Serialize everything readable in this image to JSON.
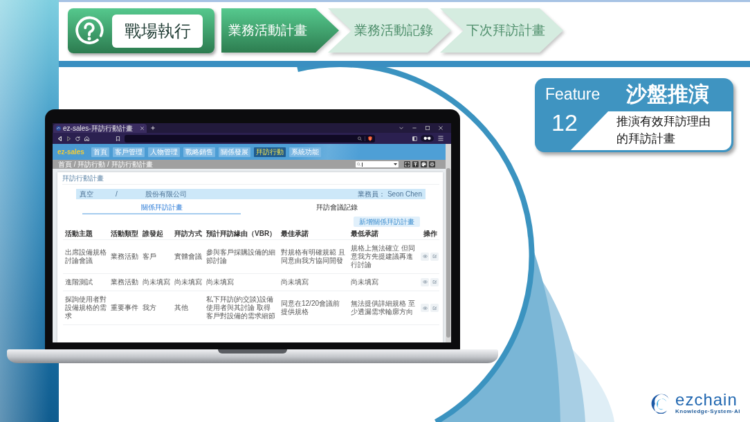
{
  "header": {
    "badge": "戰場執行",
    "steps": [
      {
        "label": "業務活動計畫",
        "selected": true
      },
      {
        "label": "業務活動記錄",
        "selected": false
      },
      {
        "label": "下次拜訪計畫",
        "selected": false
      }
    ]
  },
  "feature": {
    "label": "Feature",
    "title": "沙盤推演",
    "number": "12",
    "description": "推演有效拜訪理由的拜訪計畫"
  },
  "browser": {
    "tab_title": "ez-sales-拜訪行動計畫"
  },
  "app": {
    "logo": "ez-sales",
    "nav": [
      {
        "label": "首頁",
        "selected": false
      },
      {
        "label": "客戶管理",
        "selected": false
      },
      {
        "label": "人物管理",
        "selected": false
      },
      {
        "label": "戰略銷售",
        "selected": false
      },
      {
        "label": "關係發展",
        "selected": false
      },
      {
        "label": "拜訪行動",
        "selected": true
      },
      {
        "label": "系統功能",
        "selected": false
      }
    ],
    "breadcrumb": "首頁 / 拜訪行動 / 拜訪行動計畫"
  },
  "panel": {
    "title": "拜訪行動計畫",
    "info": [
      "真空",
      "/",
      "股份有限公司"
    ],
    "salesperson": "業務員： Seon Chen",
    "tabs": [
      {
        "label": "關係拜訪計畫",
        "selected": true
      },
      {
        "label": "拜訪會議記錄",
        "selected": false
      }
    ],
    "add_button": "新增關係拜訪計畫",
    "table": {
      "columns": [
        "活動主題",
        "活動類型",
        "誰發起",
        "拜訪方式",
        "預計拜訪緣由（VBR）",
        "最佳承諾",
        "最低承諾",
        "操作"
      ],
      "rows": [
        {
          "cells": [
            "出席設備規格討論會議",
            "業務活動",
            "客戶",
            "實體會議",
            "參與客戶採購設備的細節討論",
            "對規格有明確規範 且同意由我方協同開發",
            "規格上無法確立 但同意我方先提建議再進行討論"
          ]
        },
        {
          "cells": [
            "進階測試",
            "業務活動",
            "尚未填寫",
            "尚未填寫",
            "尚未填寫",
            "尚未填寫",
            "尚未填寫"
          ]
        },
        {
          "cells": [
            "探詢使用者對設備規格的需求",
            "重要事件",
            "我方",
            "其他",
            "私下拜訪(約交談)設備使用者與其討論 取得客戶對設備的需求細節",
            "同意在12/20會議前提供規格",
            "無法提供詳細規格 至少透漏需求輪廓方向"
          ]
        }
      ]
    }
  },
  "brand": {
    "wordmark": "ezchain",
    "tagline": "Knowledge·System·AI"
  }
}
